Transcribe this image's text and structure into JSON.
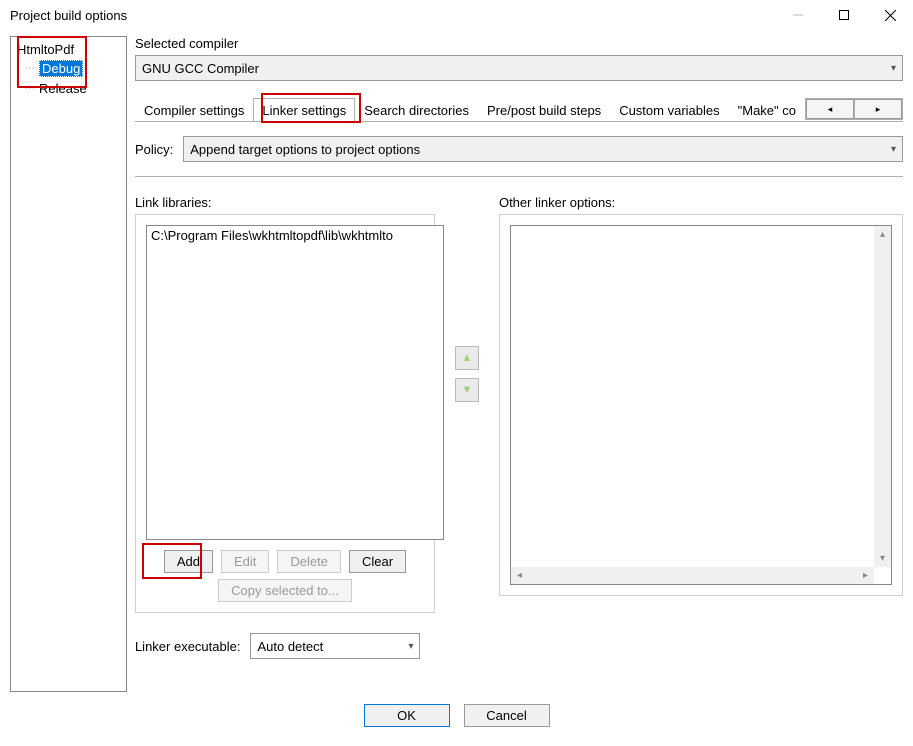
{
  "window": {
    "title": "Project build options"
  },
  "tree": {
    "root": "HtmltoPdf",
    "children": [
      "Debug",
      "Release"
    ],
    "selected_index": 0
  },
  "compiler": {
    "label": "Selected compiler",
    "value": "GNU GCC Compiler"
  },
  "tabs": {
    "items": [
      "Compiler settings",
      "Linker settings",
      "Search directories",
      "Pre/post build steps",
      "Custom variables",
      "\"Make\" co"
    ],
    "active_index": 1
  },
  "policy": {
    "label": "Policy:",
    "value": "Append target options to project options"
  },
  "link_libraries": {
    "label": "Link libraries:",
    "items": [
      "C:\\Program Files\\wkhtmltopdf\\lib\\wkhtmlto"
    ],
    "buttons": {
      "add": "Add",
      "edit": "Edit",
      "delete": "Delete",
      "clear": "Clear",
      "copy": "Copy selected to..."
    }
  },
  "other_linker": {
    "label": "Other linker options:",
    "value": ""
  },
  "linker_exec": {
    "label": "Linker executable:",
    "value": "Auto detect"
  },
  "footer": {
    "ok": "OK",
    "cancel": "Cancel"
  },
  "highlights": {
    "debug": true,
    "linker_tab": true,
    "add_button": true
  }
}
